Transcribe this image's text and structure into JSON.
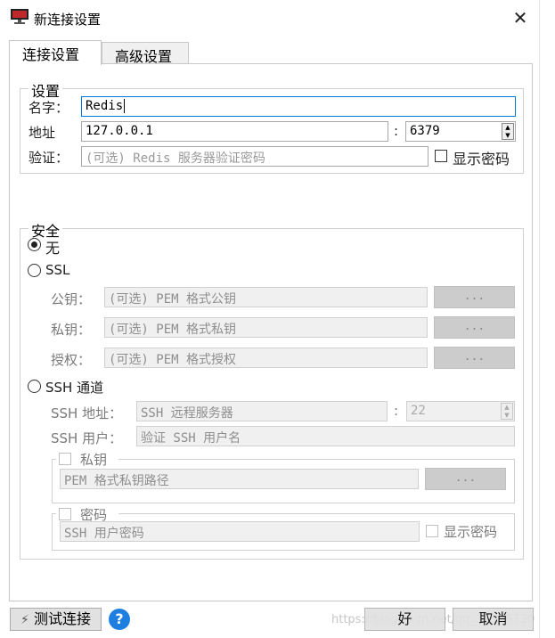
{
  "window": {
    "title": "新连接设置",
    "close_glyph": "✕"
  },
  "tabs": [
    {
      "label": "连接设置"
    },
    {
      "label": "高级设置"
    }
  ],
  "settings": {
    "legend": "设置",
    "name_label": "名字：",
    "name_value": "Redis",
    "address_label": "地址",
    "host_value": "127.0.0.1",
    "colon": ":",
    "port_value": "6379",
    "auth_label": "验证：",
    "auth_placeholder": "(可选) Redis 服务器验证密码",
    "show_password_label": "显示密码"
  },
  "security": {
    "legend": "安全",
    "none_label": "无",
    "ssl_label": "SSL",
    "public_key_label": "公钥：",
    "public_key_placeholder": "(可选) PEM 格式公钥",
    "private_key_label": "私钥：",
    "private_key_placeholder": "(可选) PEM 格式私钥",
    "authority_label": "授权：",
    "authority_placeholder": "(可选) PEM 格式授权",
    "browse_label": "...",
    "ssh_label": "SSH 通道",
    "ssh_address_label": "SSH 地址：",
    "ssh_address_placeholder": "SSH 远程服务器",
    "ssh_colon": ":",
    "ssh_port_value": "22",
    "ssh_user_label": "SSH 用户：",
    "ssh_user_placeholder": "验证 SSH 用户名",
    "private_key_group_label": "私钥",
    "private_key_path_placeholder": "PEM 格式私钥路径",
    "password_group_label": "密码",
    "ssh_password_placeholder": "SSH 用户密码",
    "ssh_show_password_label": "显示密码"
  },
  "footer": {
    "test_connection_label": "测试连接",
    "help_glyph": "?",
    "ok_label": "好",
    "cancel_label": "取消",
    "watermark": "https://blog.csdn.net/qq_36396730"
  },
  "colors": {
    "accent": "#0078d7",
    "help": "#1f7fe0",
    "app_icon": "#c0292b"
  }
}
